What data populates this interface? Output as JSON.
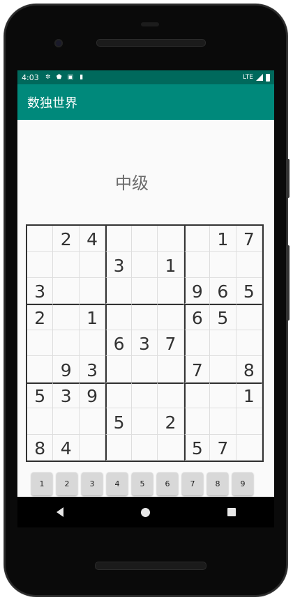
{
  "status_bar": {
    "time": "4:03",
    "network": "LTE",
    "icons": [
      "settings-icon",
      "shield-icon",
      "notification-icon",
      "sd-card-icon",
      "signal-icon",
      "battery-icon"
    ]
  },
  "app_bar": {
    "title": "数独世界"
  },
  "level_label": "中级",
  "board": [
    [
      "",
      "2",
      "4",
      "",
      "",
      "",
      "",
      "1",
      "7"
    ],
    [
      "",
      "",
      "",
      "3",
      "",
      "1",
      "",
      "",
      ""
    ],
    [
      "3",
      "",
      "",
      "",
      "",
      "",
      "9",
      "6",
      "5"
    ],
    [
      "2",
      "",
      "1",
      "",
      "",
      "",
      "6",
      "5",
      ""
    ],
    [
      "",
      "",
      "",
      "6",
      "3",
      "7",
      "",
      "",
      ""
    ],
    [
      "",
      "9",
      "3",
      "",
      "",
      "",
      "7",
      "",
      "8"
    ],
    [
      "5",
      "3",
      "9",
      "",
      "",
      "",
      "",
      "",
      "1"
    ],
    [
      "",
      "",
      "",
      "5",
      "",
      "2",
      "",
      "",
      ""
    ],
    [
      "8",
      "4",
      "",
      "",
      "",
      "",
      "5",
      "7",
      ""
    ]
  ],
  "keypad": [
    "1",
    "2",
    "3",
    "4",
    "5",
    "6",
    "7",
    "8",
    "9"
  ],
  "nav": [
    "back-icon",
    "home-icon",
    "recent-apps-icon"
  ],
  "colors": {
    "status_bar": "#00695c",
    "app_bar": "#00897b",
    "background": "#fafafa",
    "digit": "#333333"
  }
}
